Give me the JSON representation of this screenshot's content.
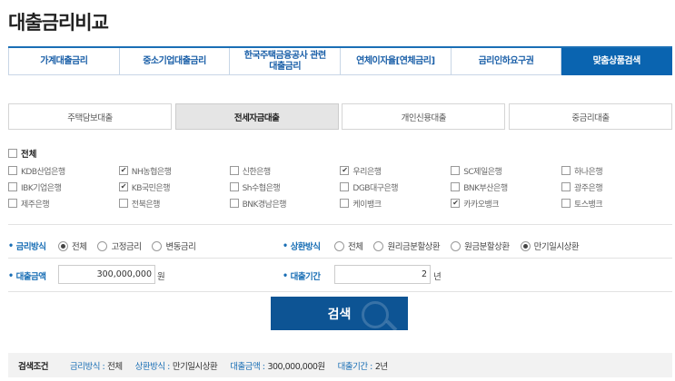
{
  "page": {
    "title": "대출금리비교"
  },
  "top_tabs": [
    {
      "label": "가계대출금리",
      "active": false
    },
    {
      "label": "중소기업대출금리",
      "active": false
    },
    {
      "label": "한국주택금융공사 관련\n대출금리",
      "active": false
    },
    {
      "label": "연체이자율[연체금리]",
      "active": false
    },
    {
      "label": "금리인하요구권",
      "active": false
    },
    {
      "label": "맞춤상품검색",
      "active": true
    }
  ],
  "sub_tabs": [
    {
      "label": "주택담보대출",
      "active": false
    },
    {
      "label": "전세자금대출",
      "active": true
    },
    {
      "label": "개인신용대출",
      "active": false
    },
    {
      "label": "중금리대출",
      "active": false
    }
  ],
  "banks": {
    "all_label": "전체",
    "all_checked": false,
    "rows": [
      [
        {
          "label": "KDB산업은행",
          "checked": false
        },
        {
          "label": "NH농협은행",
          "checked": true
        },
        {
          "label": "신한은행",
          "checked": false
        },
        {
          "label": "우리은행",
          "checked": true
        },
        {
          "label": "SC제일은행",
          "checked": false
        },
        {
          "label": "하나은행",
          "checked": false
        }
      ],
      [
        {
          "label": "IBK기업은행",
          "checked": false
        },
        {
          "label": "KB국민은행",
          "checked": true
        },
        {
          "label": "Sh수협은행",
          "checked": false
        },
        {
          "label": "DGB대구은행",
          "checked": false
        },
        {
          "label": "BNK부산은행",
          "checked": false
        },
        {
          "label": "광주은행",
          "checked": false
        }
      ],
      [
        {
          "label": "제주은행",
          "checked": false
        },
        {
          "label": "전북은행",
          "checked": false
        },
        {
          "label": "BNK경남은행",
          "checked": false
        },
        {
          "label": "케이뱅크",
          "checked": false
        },
        {
          "label": "카카오뱅크",
          "checked": true
        },
        {
          "label": "토스뱅크",
          "checked": false
        }
      ]
    ]
  },
  "rate_type": {
    "label": "금리방식",
    "options": [
      {
        "label": "전체",
        "selected": true
      },
      {
        "label": "고정금리",
        "selected": false
      },
      {
        "label": "변동금리",
        "selected": false
      }
    ]
  },
  "repay_type": {
    "label": "상환방식",
    "options": [
      {
        "label": "전체",
        "selected": false
      },
      {
        "label": "원리금분할상환",
        "selected": false
      },
      {
        "label": "원금분할상환",
        "selected": false
      },
      {
        "label": "만기일시상환",
        "selected": true
      }
    ]
  },
  "amount": {
    "label": "대출금액",
    "value": "300,000,000",
    "unit": "원"
  },
  "period": {
    "label": "대출기간",
    "value": "2",
    "unit": "년"
  },
  "search_button": {
    "label": "검색"
  },
  "summary": {
    "head": "검색조건",
    "items": [
      {
        "key": "금리방식 :",
        "value": "전체"
      },
      {
        "key": "상환방식 :",
        "value": "만기일시상환"
      },
      {
        "key": "대출금액 :",
        "value": "300,000,000원"
      },
      {
        "key": "대출기간 :",
        "value": "2년"
      }
    ]
  }
}
